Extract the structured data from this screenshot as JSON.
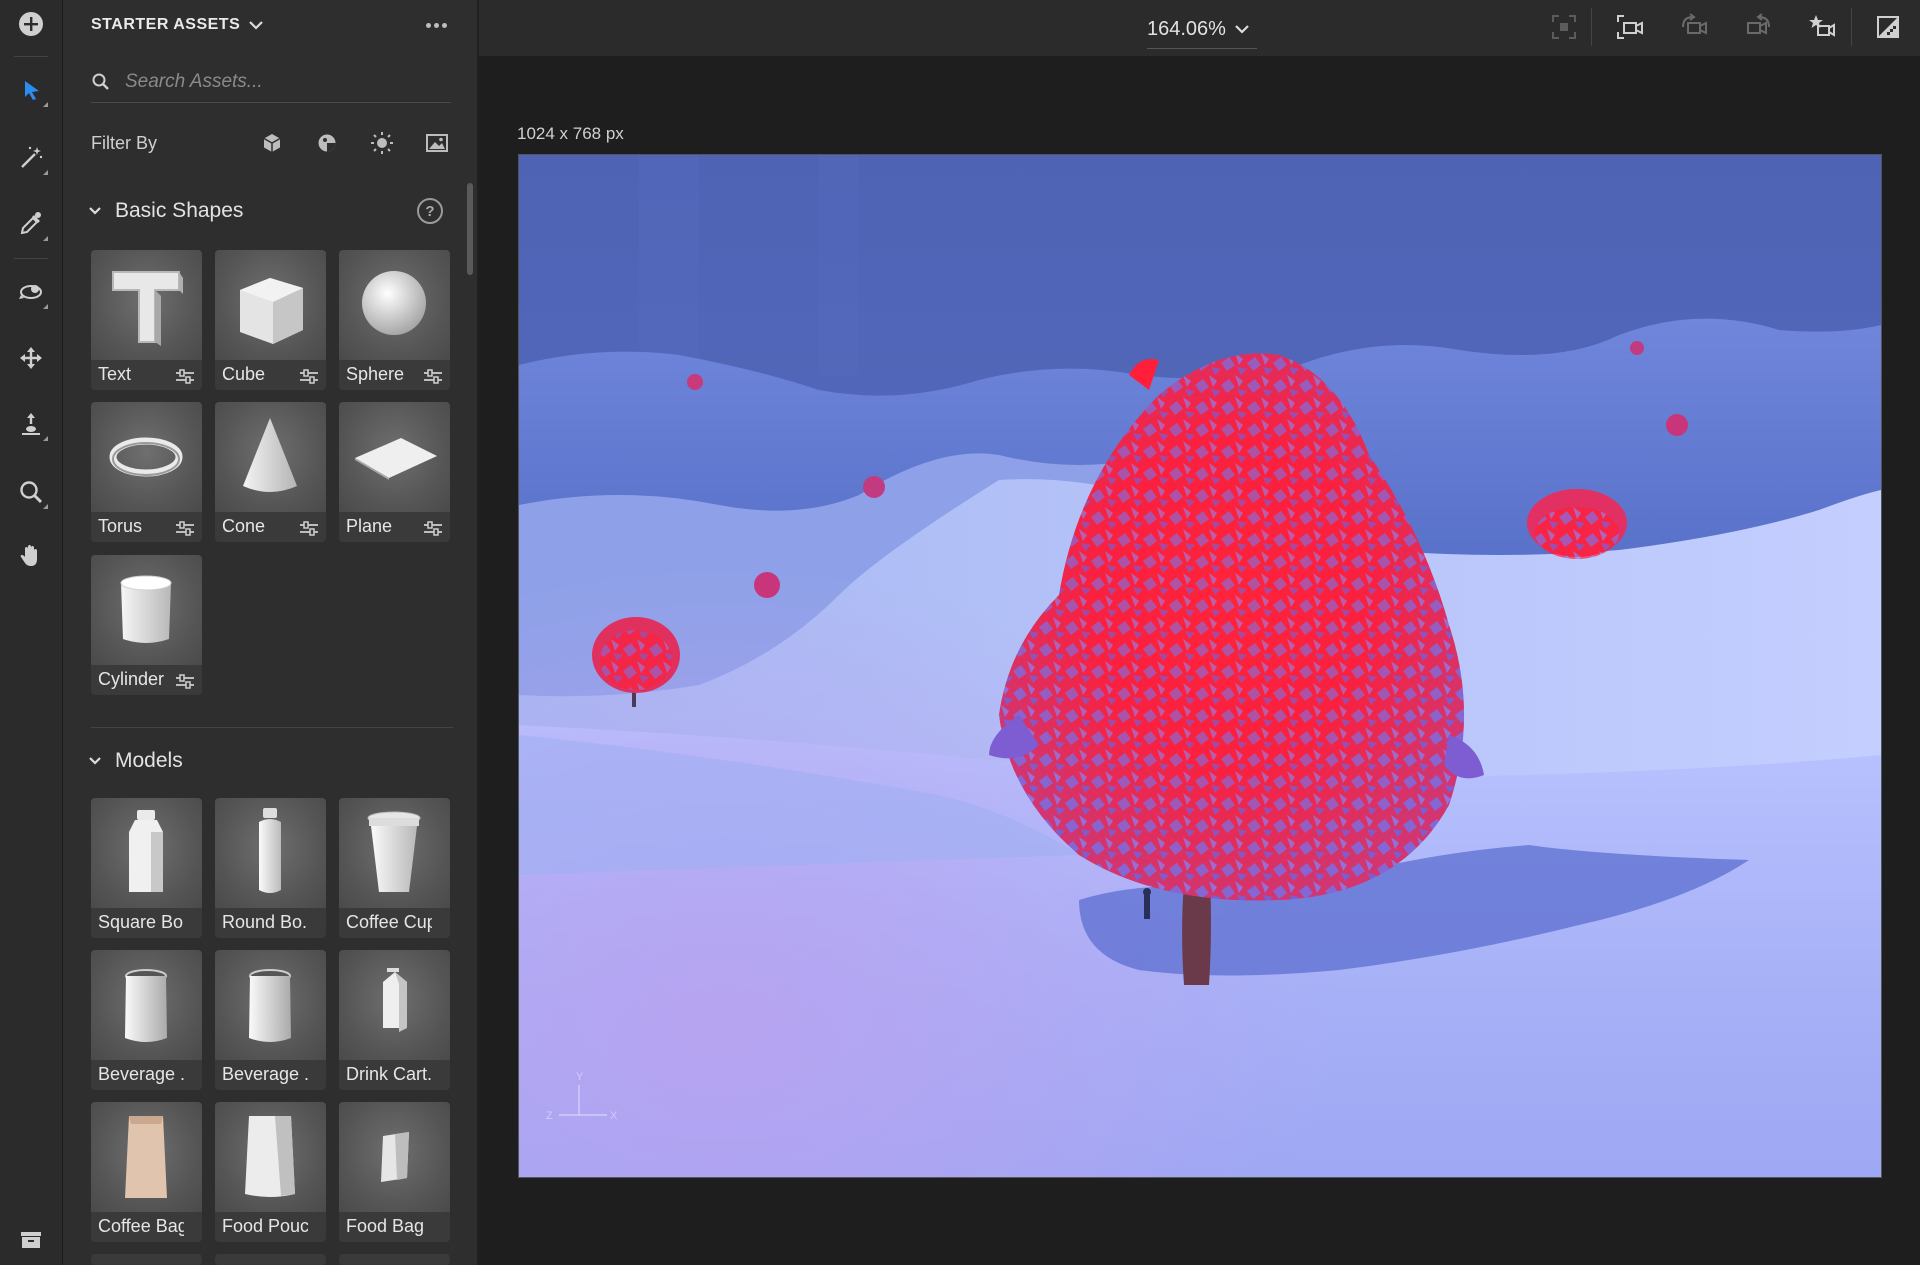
{
  "panel": {
    "title": "STARTER ASSETS",
    "search_placeholder": "Search Assets...",
    "filter_label": "Filter By",
    "filter_icons": [
      "model-filter-icon",
      "material-filter-icon",
      "light-filter-icon",
      "image-filter-icon"
    ]
  },
  "sections": {
    "basic_shapes": {
      "title": "Basic Shapes",
      "help": "?",
      "items": [
        "Text",
        "Cube",
        "Sphere",
        "Torus",
        "Cone",
        "Plane",
        "Cylinder"
      ]
    },
    "models": {
      "title": "Models",
      "items": [
        "Square Bo...",
        "Round Bo...",
        "Coffee Cup",
        "Beverage ...",
        "Beverage ...",
        "Drink Cart...",
        "Coffee Bag",
        "Food Pouch",
        "Food Bag"
      ]
    }
  },
  "topbar": {
    "zoom": "164.06%"
  },
  "canvas": {
    "dimensions": "1024 x 768 px",
    "axis_labels": {
      "y": "Y",
      "z": "Z",
      "x": "X"
    }
  },
  "colors": {
    "accent": "#2d8cf0",
    "tree_foliage": "#ff1f3a",
    "sky": "#5468b8",
    "snow": "#a9b3f5"
  }
}
